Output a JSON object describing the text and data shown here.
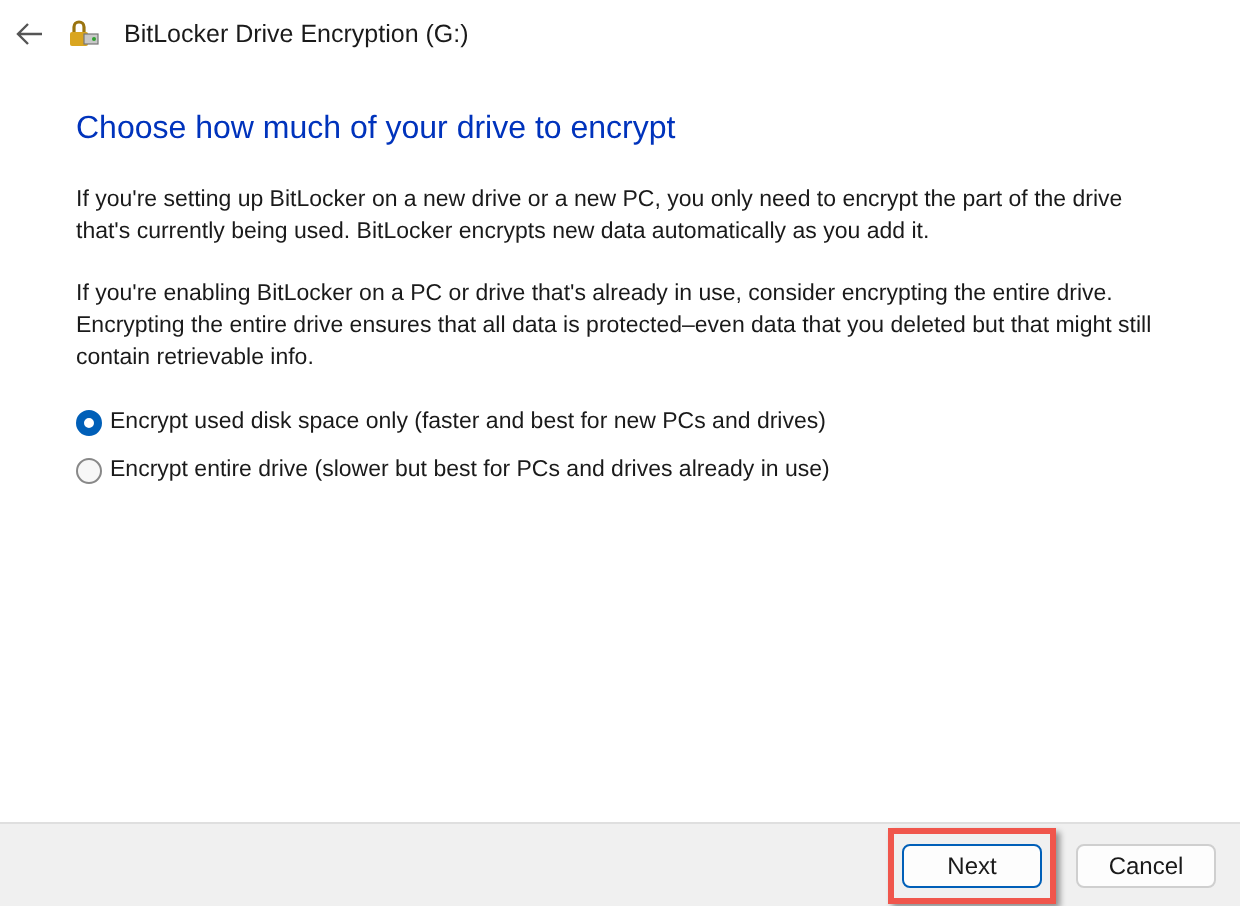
{
  "window": {
    "title": "BitLocker Drive Encryption (G:)"
  },
  "heading": "Choose how much of your drive to encrypt",
  "paragraphs": [
    "If you're setting up BitLocker on a new drive or a new PC, you only need to encrypt the part of the drive that's currently being used. BitLocker encrypts new data automatically as you add it.",
    "If you're enabling BitLocker on a PC or drive that's already in use, consider encrypting the entire drive. Encrypting the entire drive ensures that all data is protected–even data that you deleted but that might still contain retrievable info."
  ],
  "options": [
    {
      "label": "Encrypt used disk space only (faster and best for new PCs and drives)",
      "selected": true
    },
    {
      "label": "Encrypt entire drive (slower but best for PCs and drives already in use)",
      "selected": false
    }
  ],
  "buttons": [
    {
      "label": "Next",
      "default": true,
      "highlighted": true
    },
    {
      "label": "Cancel",
      "default": false,
      "highlighted": false
    }
  ]
}
